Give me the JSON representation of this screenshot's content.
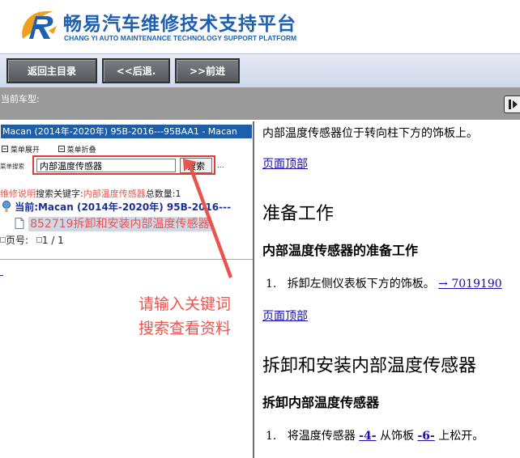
{
  "brand": {
    "title": "畅易汽车维修技术支持平台",
    "subtitle": "CHANG YI AUTO MAINTENANCE TECHNOLOGY SUPPORT PLATFORM"
  },
  "toolbar": {
    "home_label": "返回主目录",
    "back_label": "<<后退.",
    "forward_label": ">>前进"
  },
  "model_bar": {
    "label": "当前车型:",
    "button_icon": "arrow-right-icon"
  },
  "tree": {
    "title": "Macan (2014年-2020年) 95B-2016---95BAA1 - Macan",
    "expand_label": "菜单展开",
    "collapse_label": "菜单折叠",
    "search_caption": "菜单搜索",
    "search_value": "内部温度传感器",
    "search_button": "搜索",
    "search_ellipsis": "...",
    "result_prefix": "维修说明",
    "result_keyword_label": "搜索关键字:",
    "result_keyword": "内部温度传感器",
    "result_count_label": "总数量:",
    "result_count": "1",
    "current_line": "当前:Macan (2014年-2020年) 95B-2016---",
    "result_item": "852719拆卸和安装内部温度传感器",
    "page_label": "页号:",
    "page_value": "1 / 1"
  },
  "annotation": {
    "line1": "请输入关键词",
    "line2": "搜索查看资料"
  },
  "content": {
    "intro": "内部温度传感器位于转向柱下方的饰板上。",
    "top_link_1": "页面顶部",
    "heading_prep": "准备工作",
    "sub_prep": "内部温度传感器的准备工作",
    "step1_num": "1.",
    "step1_text": "拆卸左侧仪表板下方的饰板。",
    "step1_link": "→ 7019190",
    "top_link_2": "页面顶部",
    "heading_remove": "拆卸和安装内部温度传感器",
    "sub_remove": "拆卸内部温度传感器",
    "step2_num": "1.",
    "step2_a": "将温度传感器 ",
    "step2_ref1": "-4-",
    "step2_b": " 从饰板 ",
    "step2_ref2": "-6-",
    "step2_c": " 上松开。"
  },
  "colors": {
    "brand_blue": "#1d5fb0",
    "tree_header": "#1f5ea8",
    "annotation_red": "#e8554f",
    "link_blue": "#1a0dab"
  }
}
